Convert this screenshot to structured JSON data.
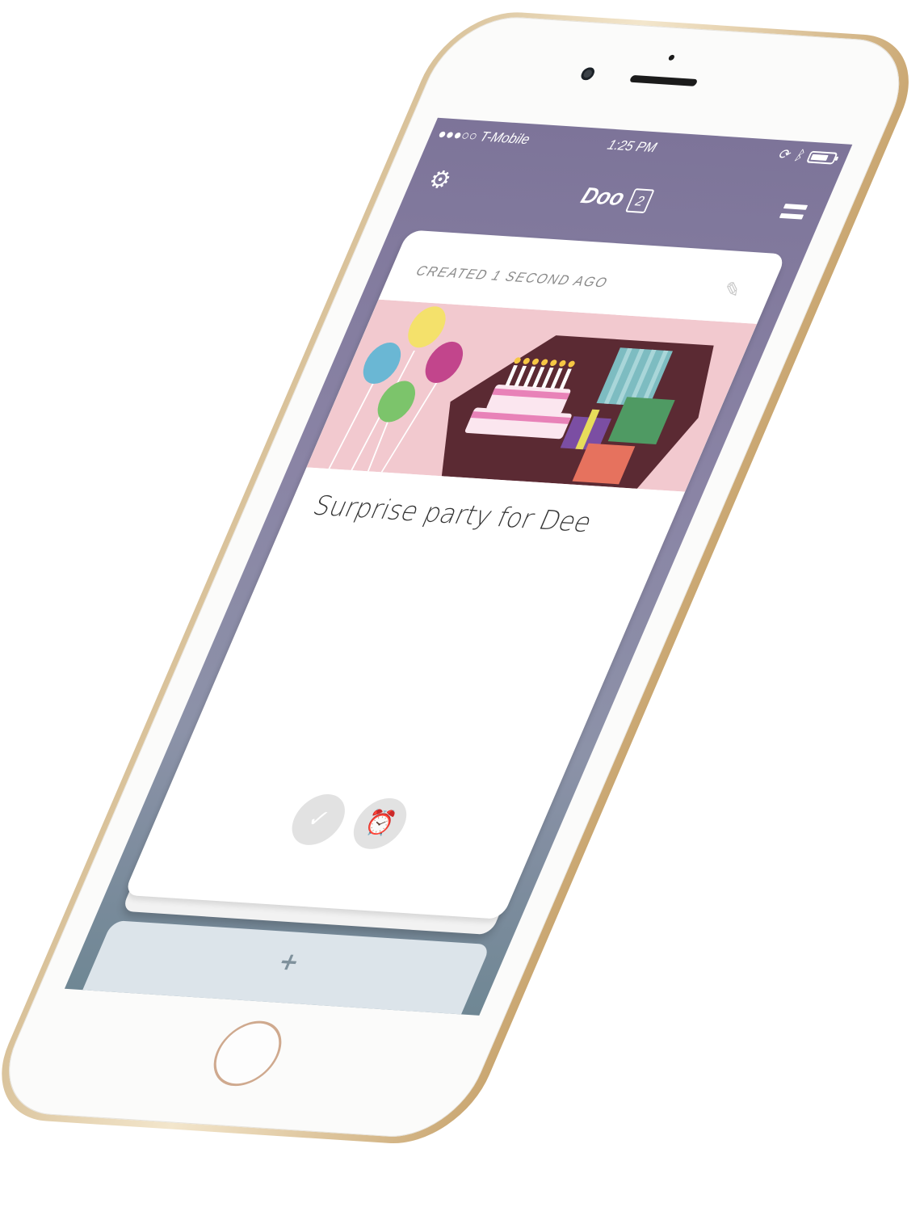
{
  "status_bar": {
    "carrier": "●●●○○ T-Mobile",
    "wifi_icon": "wifi-icon",
    "time": "1:25 PM",
    "battery_level": 0.75
  },
  "nav": {
    "settings_icon": "gear-icon",
    "title": "Doo",
    "count": "2",
    "menu_icon": "menu-icon"
  },
  "card": {
    "meta": "Created 1 second ago",
    "edit_icon": "edit-icon",
    "illustration": "birthday-party-illustration",
    "title": "Surprise party for Dee",
    "actions": [
      {
        "icon": "checkmark-icon",
        "glyph": "✓"
      },
      {
        "icon": "alarm-clock-icon",
        "glyph": "⏰"
      }
    ]
  },
  "add_panel": {
    "icon": "plus-icon",
    "label": "+"
  },
  "colors": {
    "header_purple": "#7d7499",
    "card_white": "#ffffff",
    "phone_gold": "#d9c29a",
    "pink_banner": "#f2c9cf",
    "cake_pink": "#e882b8"
  }
}
